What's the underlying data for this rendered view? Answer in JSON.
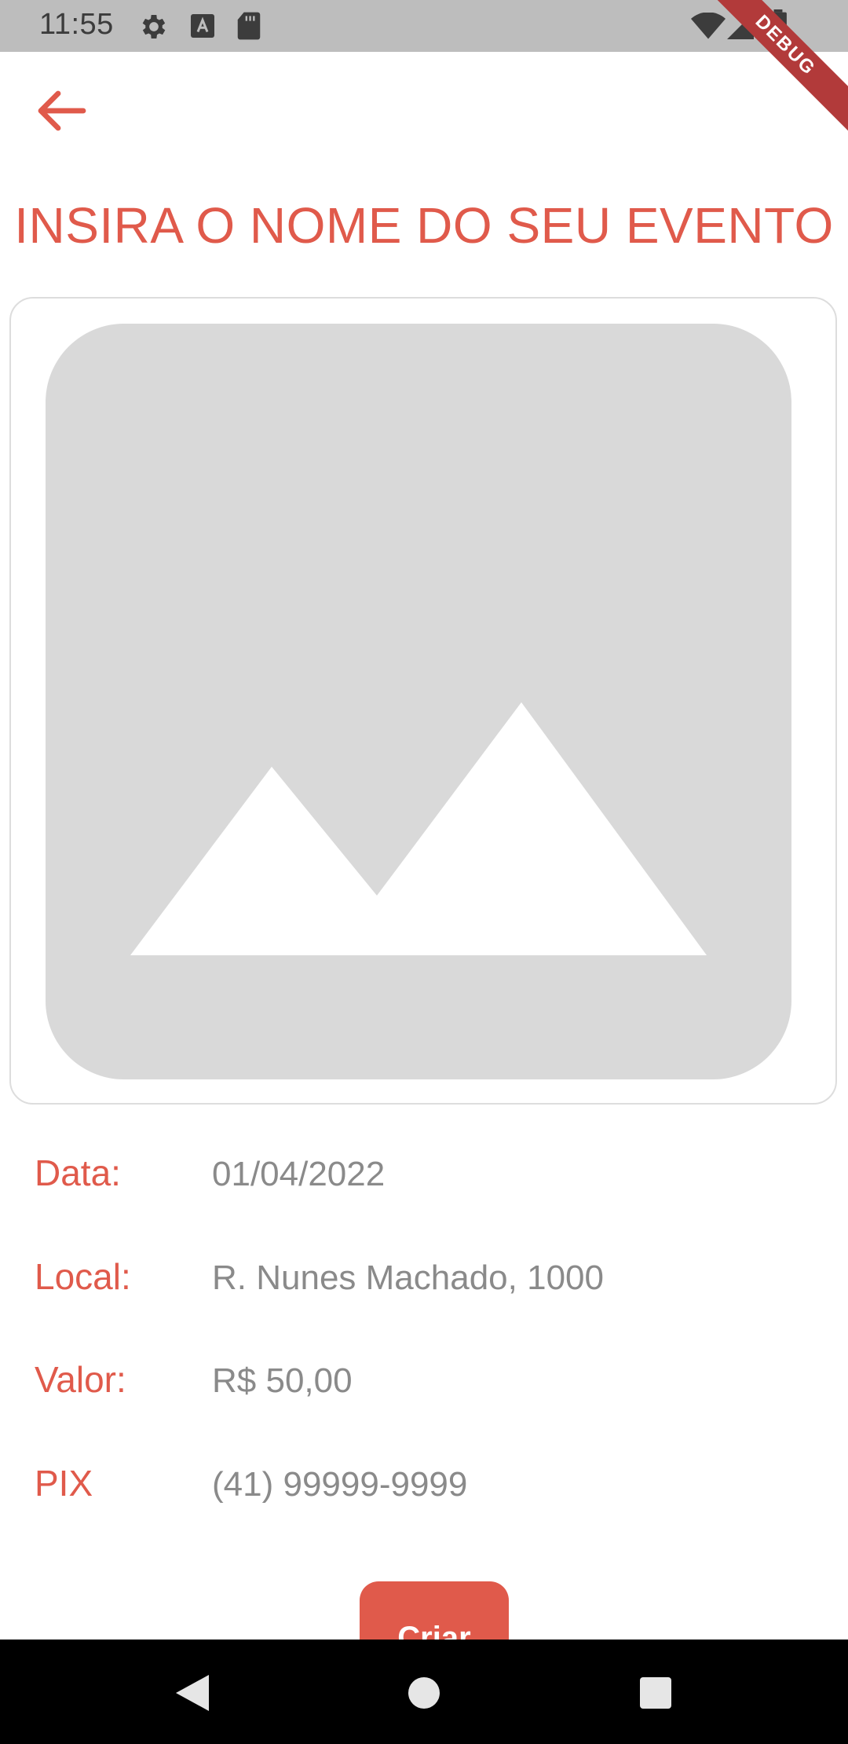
{
  "status_bar": {
    "time": "11:55",
    "left_icons": [
      "gear-icon",
      "a-box-icon",
      "sd-card-icon"
    ],
    "right_icons": [
      "wifi-icon",
      "signal-icon",
      "battery-icon"
    ],
    "debug_banner": "DEBUG"
  },
  "header": {
    "back_icon": "arrow-left-icon",
    "title": "INSIRA O NOME DO SEU EVENTO"
  },
  "image_placeholder": {
    "icon": "image-placeholder-icon"
  },
  "details": [
    {
      "label": "Data:",
      "value": "01/04/2022"
    },
    {
      "label": "Local:",
      "value": "R. Nunes Machado, 1000"
    },
    {
      "label": "Valor:",
      "value": "R$ 50,00"
    },
    {
      "label": "PIX",
      "value": "(41) 99999-9999"
    }
  ],
  "actions": {
    "create_label": "Criar"
  },
  "navigation": {
    "back_icon": "nav-back-icon",
    "home_icon": "nav-home-icon",
    "recents_icon": "nav-recents-icon"
  },
  "colors": {
    "accent": "#e05a4b",
    "value_text": "#8a8a8a",
    "placeholder_bg": "#d9d9d9",
    "status_bar_bg": "#bdbdbd",
    "debug_ribbon": "#b23a3a"
  }
}
